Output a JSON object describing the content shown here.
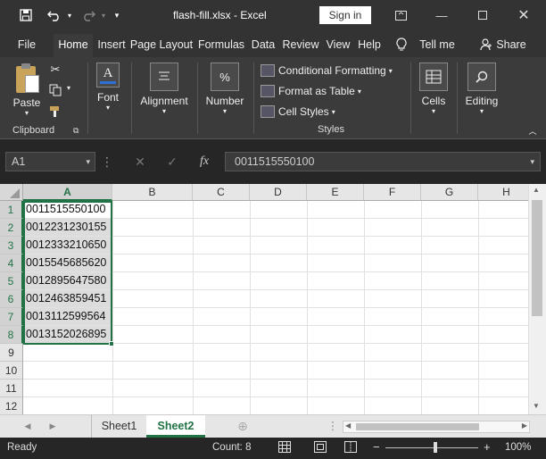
{
  "titlebar": {
    "title": "flash-fill.xlsx  -  Excel",
    "signin": "Sign in",
    "save_icon": "save-icon",
    "undo_icon": "undo-icon",
    "redo_icon": "redo-icon",
    "customize_icon": "customize-qat-icon"
  },
  "ribbon_tabs": [
    "File",
    "Home",
    "Insert",
    "Page Layout",
    "Formulas",
    "Data",
    "Review",
    "View",
    "Help"
  ],
  "tell_me": "Tell me",
  "share": "Share",
  "ribbon": {
    "clipboard": {
      "paste": "Paste",
      "label": "Clipboard"
    },
    "font": {
      "label": "Font"
    },
    "alignment": {
      "label": "Alignment"
    },
    "number": {
      "label": "Number"
    },
    "styles": {
      "conditional": "Conditional Formatting",
      "format_table": "Format as Table",
      "cell_styles": "Cell Styles",
      "label": "Styles"
    },
    "cells": {
      "label": "Cells"
    },
    "editing": {
      "label": "Editing"
    }
  },
  "formula_bar": {
    "name_box": "A1",
    "value": "0011515550100"
  },
  "columns": [
    "A",
    "B",
    "C",
    "D",
    "E",
    "F",
    "G",
    "H"
  ],
  "rows": [
    "1",
    "2",
    "3",
    "4",
    "5",
    "6",
    "7",
    "8",
    "9",
    "10",
    "11",
    "12"
  ],
  "column_a_values": [
    "0011515550100",
    "0012231230155",
    "0012333210650",
    "0015545685620",
    "0012895647580",
    "0012463859451",
    "0013112599564",
    "0013152026895"
  ],
  "sheets": {
    "tabs": [
      "Sheet1",
      "Sheet2"
    ],
    "active": "Sheet2"
  },
  "status": {
    "ready": "Ready",
    "count": "Count: 8",
    "zoom": "100%"
  },
  "colors": {
    "accent": "#217346",
    "titlebar": "#333333",
    "ribbon": "#3b3b3b"
  }
}
